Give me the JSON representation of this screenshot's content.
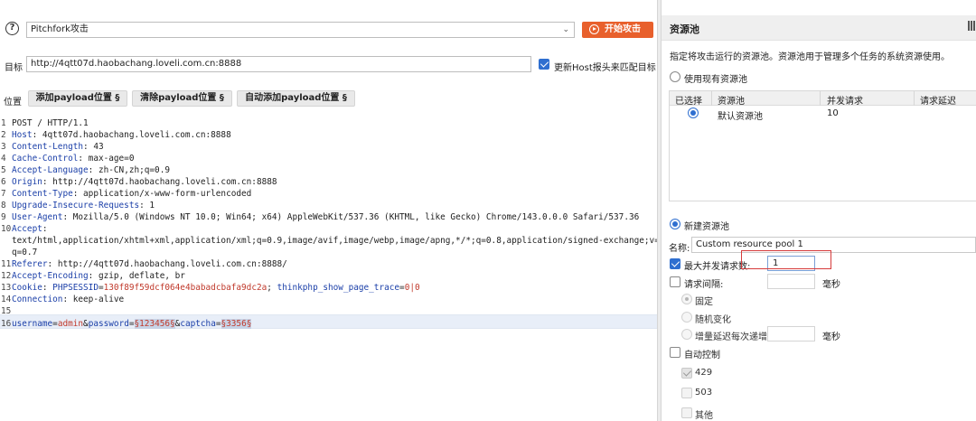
{
  "top_tabs": [
    "tab-1",
    "tab-2",
    "tab-3"
  ],
  "attack": {
    "help_glyph": "?",
    "attack_type": "Pitchfork攻击",
    "start_label": "开始攻击",
    "target_label": "目标",
    "target_url": "http://4qtt07d.haobachang.loveli.com.cn:8888",
    "update_host_label": "更新Host报头来匹配目标",
    "update_host_checked": true
  },
  "positions": {
    "label": "位置",
    "add_label": "添加payload位置 §",
    "clear_label": "清除payload位置 §",
    "auto_label": "自动添加payload位置 §"
  },
  "request": {
    "line_numbers": [
      "1",
      "2",
      "3",
      "4",
      "5",
      "6",
      "7",
      "8",
      "9",
      "10",
      "",
      "",
      "11",
      "12",
      "13",
      "14",
      "15",
      "16"
    ],
    "request_line": "POST / HTTP/1.1",
    "headers": [
      {
        "k": "Host",
        "v": " 4qtt07d.haobachang.loveli.com.cn:8888"
      },
      {
        "k": "Content-Length",
        "v": " 43"
      },
      {
        "k": "Cache-Control",
        "v": " max-age=0"
      },
      {
        "k": "Accept-Language",
        "v": " zh-CN,zh;q=0.9"
      },
      {
        "k": "Origin",
        "v": " http://4qtt07d.haobachang.loveli.com.cn:8888"
      },
      {
        "k": "Content-Type",
        "v": " application/x-www-form-urlencoded"
      },
      {
        "k": "Upgrade-Insecure-Requests",
        "v": " 1"
      },
      {
        "k": "User-Agent",
        "v": " Mozilla/5.0 (Windows NT 10.0; Win64; x64) AppleWebKit/537.36 (KHTML, like Gecko) Chrome/143.0.0.0 Safari/537.36"
      }
    ],
    "accept_key": "Accept",
    "accept_cont_1": "text/html,application/xhtml+xml,application/xml;q=0.9,image/avif,image/webp,image/apng,*/*;q=0.8,application/signed-exchange;v=b3;",
    "accept_cont_2": "q=0.7",
    "headers2": [
      {
        "k": "Referer",
        "v": " http://4qtt07d.haobachang.loveli.com.cn:8888/"
      },
      {
        "k": "Accept-Encoding",
        "v": " gzip, deflate, br"
      }
    ],
    "cookie_key": "Cookie",
    "cookie_parts": [
      "PHPSESSID",
      "=",
      "130f89f59dcf064e4babadcbafa9dc2a",
      "; ",
      "thinkphp_show_page_trace",
      "=",
      "0|0"
    ],
    "connection": {
      "k": "Connection",
      "v": " keep-alive"
    },
    "body_parts": [
      "username",
      "=",
      "admin",
      "&",
      "password",
      "=",
      "§123456§",
      "&",
      "captcha",
      "=",
      "§3356§"
    ]
  },
  "resource_pool": {
    "title": "资源池",
    "description": "指定将攻击运行的资源池。资源池用于管理多个任务的系统资源使用。",
    "use_existing_label": "使用现有资源池",
    "columns": [
      "已选择",
      "资源池",
      "并发请求",
      "请求延迟"
    ],
    "rows": [
      {
        "name": "默认资源池",
        "concurrent": "10"
      }
    ],
    "create_new_label": "新建资源池",
    "name_label": "名称:",
    "name_value": "Custom resource pool 1",
    "max_concurrent_label": "最大并发请求数:",
    "max_concurrent_value": "1",
    "request_interval_label": "请求间隔:",
    "ms_label": "毫秒",
    "fixed_label": "固定",
    "random_label": "随机变化",
    "increment_label": "增量延迟每次递增",
    "auto_throttle_label": "自动控制",
    "codes": [
      "429",
      "503",
      "其他"
    ]
  }
}
